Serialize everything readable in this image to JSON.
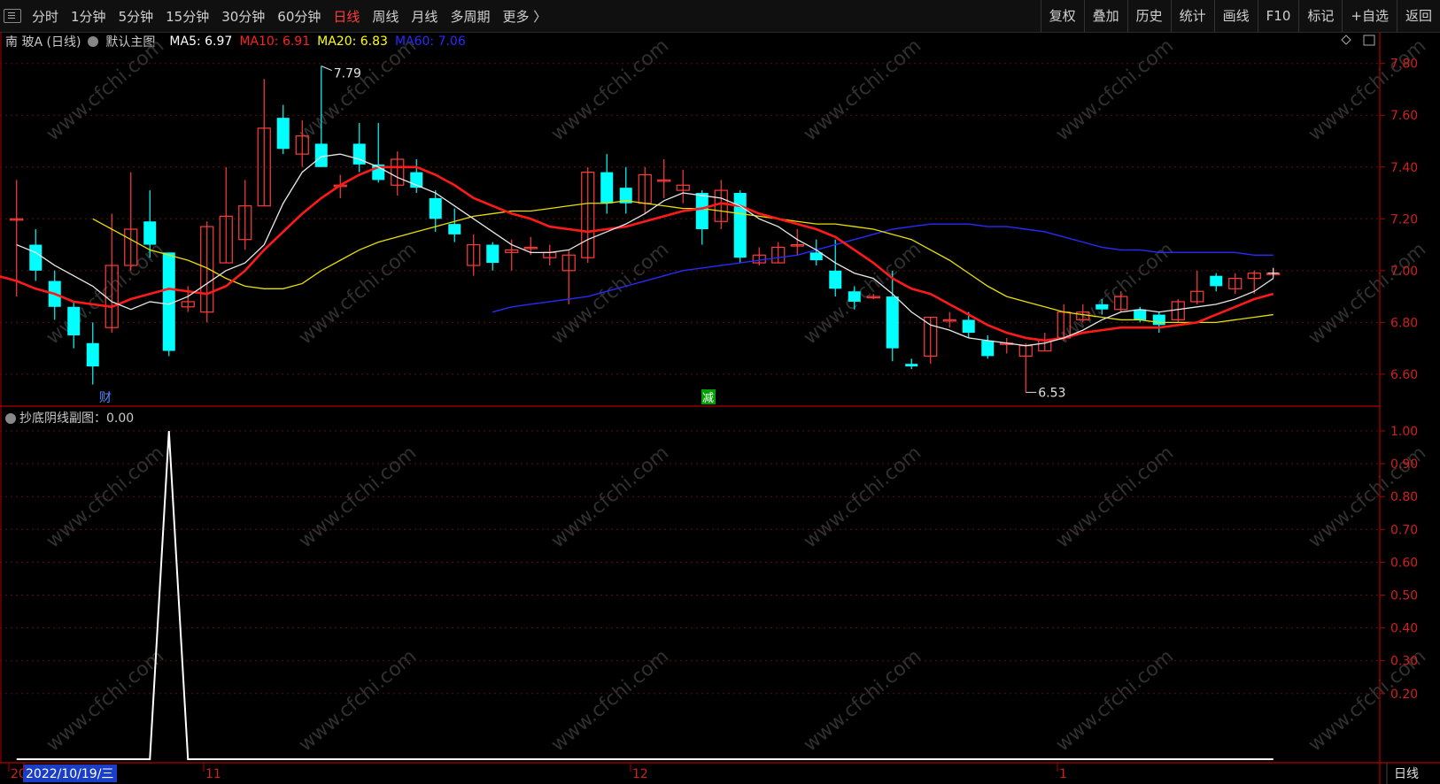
{
  "toolbar": {
    "periods": [
      {
        "label": "分时",
        "active": false
      },
      {
        "label": "1分钟",
        "active": false
      },
      {
        "label": "5分钟",
        "active": false
      },
      {
        "label": "15分钟",
        "active": false
      },
      {
        "label": "30分钟",
        "active": false
      },
      {
        "label": "60分钟",
        "active": false
      },
      {
        "label": "日线",
        "active": true
      },
      {
        "label": "周线",
        "active": false
      },
      {
        "label": "月线",
        "active": false
      },
      {
        "label": "多周期",
        "active": false
      },
      {
        "label": "更多 〉",
        "active": false
      }
    ],
    "right_items": [
      "复权",
      "叠加",
      "历史",
      "统计",
      "画线",
      "F10",
      "标记",
      "+自选",
      "返回"
    ]
  },
  "main_chart": {
    "stock": "南 玻A (日线)",
    "indicator_name": "默认主图",
    "ma": [
      {
        "label": "MA5: 6.97",
        "color": "#ffffff"
      },
      {
        "label": "MA10: 6.91",
        "color": "#ff2020"
      },
      {
        "label": "MA20: 6.83",
        "color": "#ffff00"
      },
      {
        "label": "MA60: 7.06",
        "color": "#2a2aff"
      }
    ],
    "y_ticks": [
      "7.80",
      "7.60",
      "7.40",
      "7.20",
      "7.00",
      "6.80",
      "6.60"
    ],
    "high_label": "7.79",
    "low_label": "6.53",
    "markers": [
      {
        "text": "财",
        "color": "#4a8cff"
      },
      {
        "text": "减",
        "color": "#00d000"
      }
    ]
  },
  "sub_chart": {
    "label": "抄底阴线副图：0.00",
    "y_ticks": [
      "1.00",
      "0.90",
      "0.80",
      "0.70",
      "0.60",
      "0.50",
      "0.40",
      "0.30",
      "0.20"
    ]
  },
  "x_axis": {
    "labels": [
      "20",
      "2022/10/19/三",
      "11",
      "12",
      "1"
    ],
    "period_tag": "日线"
  },
  "watermark": "www.cfchi.com",
  "chart_data": {
    "type": "candlestick",
    "ylim": [
      6.48,
      7.84
    ],
    "candles": [
      {
        "o": 7.2,
        "c": 7.2,
        "h": 7.35,
        "l": 6.9
      },
      {
        "o": 7.1,
        "c": 7.0,
        "h": 7.16,
        "l": 6.96
      },
      {
        "o": 6.96,
        "c": 6.86,
        "h": 7.0,
        "l": 6.81
      },
      {
        "o": 6.86,
        "c": 6.75,
        "h": 6.88,
        "l": 6.7
      },
      {
        "o": 6.72,
        "c": 6.63,
        "h": 6.8,
        "l": 6.56
      },
      {
        "o": 6.78,
        "c": 7.02,
        "h": 7.22,
        "l": 6.76
      },
      {
        "o": 7.02,
        "c": 7.16,
        "h": 7.38,
        "l": 7.0
      },
      {
        "o": 7.19,
        "c": 7.1,
        "h": 7.31,
        "l": 7.05
      },
      {
        "o": 7.07,
        "c": 6.69,
        "h": 7.07,
        "l": 6.67
      },
      {
        "o": 6.86,
        "c": 6.88,
        "h": 6.94,
        "l": 6.84
      },
      {
        "o": 6.84,
        "c": 7.17,
        "h": 7.19,
        "l": 6.8
      },
      {
        "o": 7.03,
        "c": 7.21,
        "h": 7.4,
        "l": 7.03
      },
      {
        "o": 7.12,
        "c": 7.25,
        "h": 7.35,
        "l": 7.08
      },
      {
        "o": 7.25,
        "c": 7.55,
        "h": 7.74,
        "l": 7.25
      },
      {
        "o": 7.59,
        "c": 7.47,
        "h": 7.64,
        "l": 7.45
      },
      {
        "o": 7.45,
        "c": 7.52,
        "h": 7.58,
        "l": 7.4
      },
      {
        "o": 7.49,
        "c": 7.4,
        "h": 7.79,
        "l": 7.4
      },
      {
        "o": 7.33,
        "c": 7.33,
        "h": 7.37,
        "l": 7.28
      },
      {
        "o": 7.49,
        "c": 7.41,
        "h": 7.57,
        "l": 7.38
      },
      {
        "o": 7.41,
        "c": 7.35,
        "h": 7.57,
        "l": 7.34
      },
      {
        "o": 7.33,
        "c": 7.43,
        "h": 7.46,
        "l": 7.29
      },
      {
        "o": 7.38,
        "c": 7.32,
        "h": 7.43,
        "l": 7.3
      },
      {
        "o": 7.28,
        "c": 7.2,
        "h": 7.31,
        "l": 7.15
      },
      {
        "o": 7.18,
        "c": 7.14,
        "h": 7.24,
        "l": 7.11
      },
      {
        "o": 7.02,
        "c": 7.1,
        "h": 7.14,
        "l": 6.98
      },
      {
        "o": 7.1,
        "c": 7.03,
        "h": 7.11,
        "l": 7.0
      },
      {
        "o": 7.07,
        "c": 7.08,
        "h": 7.12,
        "l": 7.0
      },
      {
        "o": 7.09,
        "c": 7.09,
        "h": 7.13,
        "l": 7.06
      },
      {
        "o": 7.05,
        "c": 7.07,
        "h": 7.1,
        "l": 7.02
      },
      {
        "o": 7.0,
        "c": 7.06,
        "h": 7.08,
        "l": 6.87
      },
      {
        "o": 7.05,
        "c": 7.38,
        "h": 7.4,
        "l": 7.03
      },
      {
        "o": 7.38,
        "c": 7.26,
        "h": 7.45,
        "l": 7.22
      },
      {
        "o": 7.32,
        "c": 7.26,
        "h": 7.4,
        "l": 7.22
      },
      {
        "o": 7.26,
        "c": 7.37,
        "h": 7.4,
        "l": 7.22
      },
      {
        "o": 7.35,
        "c": 7.35,
        "h": 7.43,
        "l": 7.28
      },
      {
        "o": 7.31,
        "c": 7.33,
        "h": 7.39,
        "l": 7.26
      },
      {
        "o": 7.3,
        "c": 7.16,
        "h": 7.31,
        "l": 7.1
      },
      {
        "o": 7.19,
        "c": 7.31,
        "h": 7.35,
        "l": 7.16
      },
      {
        "o": 7.3,
        "c": 7.05,
        "h": 7.31,
        "l": 7.03
      },
      {
        "o": 7.03,
        "c": 7.06,
        "h": 7.09,
        "l": 7.02
      },
      {
        "o": 7.03,
        "c": 7.09,
        "h": 7.11,
        "l": 7.03
      },
      {
        "o": 7.1,
        "c": 7.1,
        "h": 7.16,
        "l": 7.06
      },
      {
        "o": 7.07,
        "c": 7.04,
        "h": 7.12,
        "l": 7.02
      },
      {
        "o": 7.0,
        "c": 6.93,
        "h": 7.12,
        "l": 6.9
      },
      {
        "o": 6.92,
        "c": 6.88,
        "h": 6.94,
        "l": 6.85
      },
      {
        "o": 6.9,
        "c": 6.9,
        "h": 6.91,
        "l": 6.89
      },
      {
        "o": 6.9,
        "c": 6.7,
        "h": 7.0,
        "l": 6.65
      },
      {
        "o": 6.64,
        "c": 6.63,
        "h": 6.66,
        "l": 6.62
      },
      {
        "o": 6.67,
        "c": 6.82,
        "h": 6.82,
        "l": 6.64
      },
      {
        "o": 6.81,
        "c": 6.81,
        "h": 6.84,
        "l": 6.78
      },
      {
        "o": 6.81,
        "c": 6.76,
        "h": 6.84,
        "l": 6.74
      },
      {
        "o": 6.73,
        "c": 6.67,
        "h": 6.75,
        "l": 6.66
      },
      {
        "o": 6.72,
        "c": 6.72,
        "h": 6.74,
        "l": 6.68
      },
      {
        "o": 6.67,
        "c": 6.71,
        "h": 6.72,
        "l": 6.53
      },
      {
        "o": 6.69,
        "c": 6.73,
        "h": 6.76,
        "l": 6.69
      },
      {
        "o": 6.74,
        "c": 6.84,
        "h": 6.87,
        "l": 6.73
      },
      {
        "o": 6.81,
        "c": 6.84,
        "h": 6.87,
        "l": 6.8
      },
      {
        "o": 6.87,
        "c": 6.85,
        "h": 6.89,
        "l": 6.83
      },
      {
        "o": 6.85,
        "c": 6.9,
        "h": 6.92,
        "l": 6.84
      },
      {
        "o": 6.85,
        "c": 6.81,
        "h": 6.86,
        "l": 6.8
      },
      {
        "o": 6.83,
        "c": 6.79,
        "h": 6.84,
        "l": 6.76
      },
      {
        "o": 6.81,
        "c": 6.88,
        "h": 6.89,
        "l": 6.8
      },
      {
        "o": 6.88,
        "c": 6.92,
        "h": 7.0,
        "l": 6.87
      },
      {
        "o": 6.98,
        "c": 6.94,
        "h": 6.99,
        "l": 6.92
      },
      {
        "o": 6.93,
        "c": 6.97,
        "h": 6.99,
        "l": 6.91
      },
      {
        "o": 6.97,
        "c": 6.99,
        "h": 7.0,
        "l": 6.91
      },
      {
        "o": 6.99,
        "c": 6.99,
        "h": 7.01,
        "l": 6.98
      }
    ],
    "ma5": [
      7.1,
      7.07,
      7.02,
      6.98,
      6.94,
      6.88,
      6.85,
      6.88,
      6.87,
      6.9,
      6.95,
      7.0,
      7.03,
      7.1,
      7.26,
      7.38,
      7.44,
      7.45,
      7.43,
      7.4,
      7.36,
      7.33,
      7.3,
      7.25,
      7.2,
      7.15,
      7.1,
      7.07,
      7.07,
      7.08,
      7.12,
      7.15,
      7.18,
      7.22,
      7.27,
      7.3,
      7.29,
      7.28,
      7.25,
      7.2,
      7.17,
      7.12,
      7.08,
      7.03,
      6.99,
      6.97,
      6.91,
      6.84,
      6.79,
      6.77,
      6.74,
      6.73,
      6.72,
      6.71,
      6.72,
      6.74,
      6.77,
      6.81,
      6.84,
      6.85,
      6.84,
      6.85,
      6.86,
      6.87,
      6.89,
      6.92,
      6.97
    ],
    "ma10": [
      6.98,
      6.96,
      6.93,
      6.91,
      6.88,
      6.87,
      6.86,
      6.89,
      6.91,
      6.93,
      6.92,
      6.91,
      6.94,
      7.0,
      7.08,
      7.15,
      7.22,
      7.28,
      7.33,
      7.37,
      7.4,
      7.4,
      7.4,
      7.37,
      7.33,
      7.28,
      7.25,
      7.22,
      7.2,
      7.17,
      7.16,
      7.15,
      7.16,
      7.17,
      7.19,
      7.21,
      7.23,
      7.24,
      7.26,
      7.25,
      7.22,
      7.2,
      7.18,
      7.16,
      7.13,
      7.08,
      7.03,
      6.97,
      6.93,
      6.91,
      6.87,
      6.83,
      6.79,
      6.76,
      6.74,
      6.73,
      6.74,
      6.76,
      6.77,
      6.78,
      6.78,
      6.78,
      6.79,
      6.8,
      6.83,
      6.86,
      6.89,
      6.91
    ],
    "ma20": [
      7.2,
      7.16,
      7.12,
      7.08,
      7.06,
      7.04,
      7.01,
      6.97,
      6.94,
      6.93,
      6.93,
      6.95,
      7.0,
      7.04,
      7.08,
      7.11,
      7.13,
      7.15,
      7.17,
      7.19,
      7.21,
      7.22,
      7.23,
      7.23,
      7.24,
      7.25,
      7.26,
      7.26,
      7.27,
      7.26,
      7.25,
      7.24,
      7.24,
      7.23,
      7.22,
      7.21,
      7.2,
      7.19,
      7.18,
      7.18,
      7.17,
      7.16,
      7.14,
      7.12,
      7.08,
      7.04,
      6.99,
      6.94,
      6.9,
      6.88,
      6.86,
      6.84,
      6.83,
      6.82,
      6.81,
      6.81,
      6.8,
      6.8,
      6.8,
      6.8,
      6.81,
      6.82,
      6.83
    ],
    "ma60": [
      6.84,
      6.86,
      6.87,
      6.88,
      6.89,
      6.9,
      6.92,
      6.94,
      6.96,
      6.98,
      7.0,
      7.01,
      7.02,
      7.03,
      7.04,
      7.05,
      7.06,
      7.08,
      7.1,
      7.12,
      7.14,
      7.16,
      7.17,
      7.18,
      7.18,
      7.18,
      7.17,
      7.17,
      7.16,
      7.15,
      7.13,
      7.11,
      7.09,
      7.08,
      7.08,
      7.07,
      7.07,
      7.07,
      7.07,
      7.07,
      7.06,
      7.06
    ],
    "sub_series": {
      "name": "抄底阴线副图",
      "ylim": [
        0,
        1.0
      ],
      "values": [
        0,
        0,
        0,
        0,
        0,
        0,
        0,
        0,
        1,
        0,
        0,
        0,
        0,
        0,
        0,
        0,
        0,
        0,
        0,
        0,
        0,
        0,
        0,
        0,
        0,
        0,
        0,
        0,
        0,
        0,
        0,
        0,
        0,
        0,
        0,
        0,
        0,
        0,
        0,
        0,
        0,
        0,
        0,
        0,
        0,
        0,
        0,
        0,
        0,
        0,
        0,
        0,
        0,
        0,
        0,
        0,
        0,
        0,
        0,
        0,
        0,
        0,
        0,
        0,
        0,
        0,
        0
      ]
    }
  }
}
